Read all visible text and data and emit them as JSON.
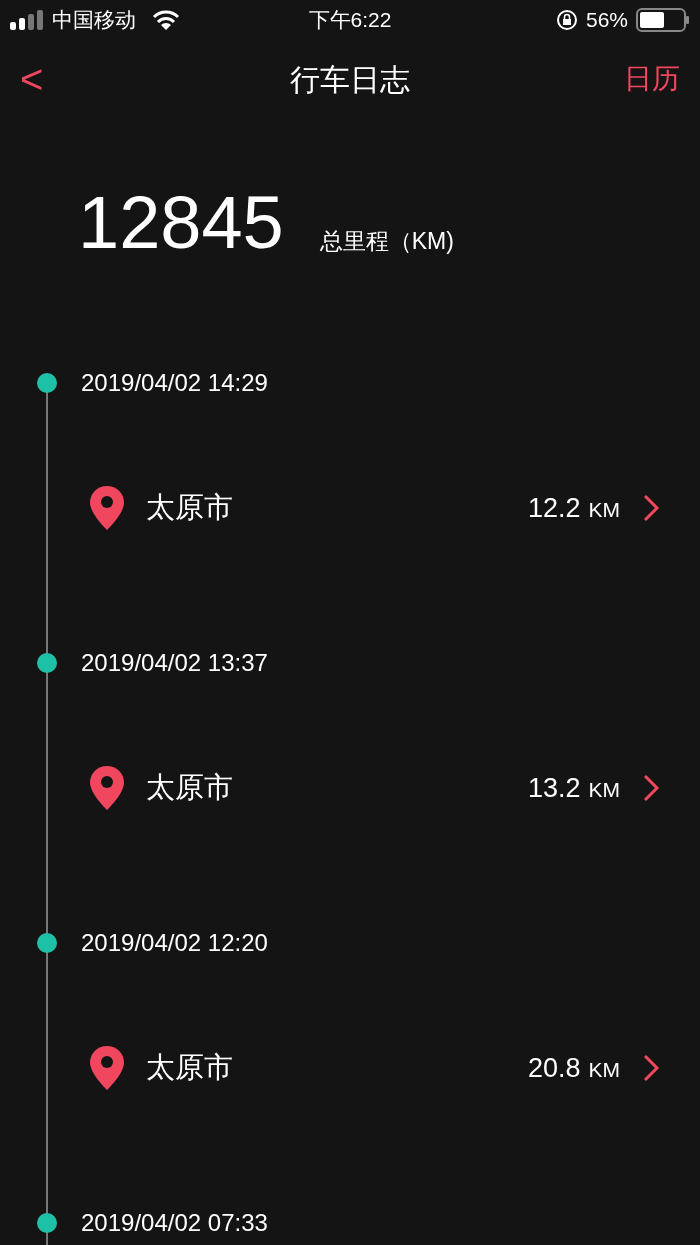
{
  "status_bar": {
    "carrier": "中国移动",
    "time": "下午6:22",
    "battery": "56%"
  },
  "nav": {
    "back": "<",
    "title": "行车日志",
    "action": "日历"
  },
  "total": {
    "value": "12845",
    "label": "总里程（KM)"
  },
  "trips": [
    {
      "datetime": "2019/04/02 14:29",
      "place": "太原市",
      "distance": "12.2",
      "unit": "KM"
    },
    {
      "datetime": "2019/04/02 13:37",
      "place": "太原市",
      "distance": "13.2",
      "unit": "KM"
    },
    {
      "datetime": "2019/04/02 12:20",
      "place": "太原市",
      "distance": "20.8",
      "unit": "KM"
    },
    {
      "datetime": "2019/04/02 07:33"
    }
  ]
}
